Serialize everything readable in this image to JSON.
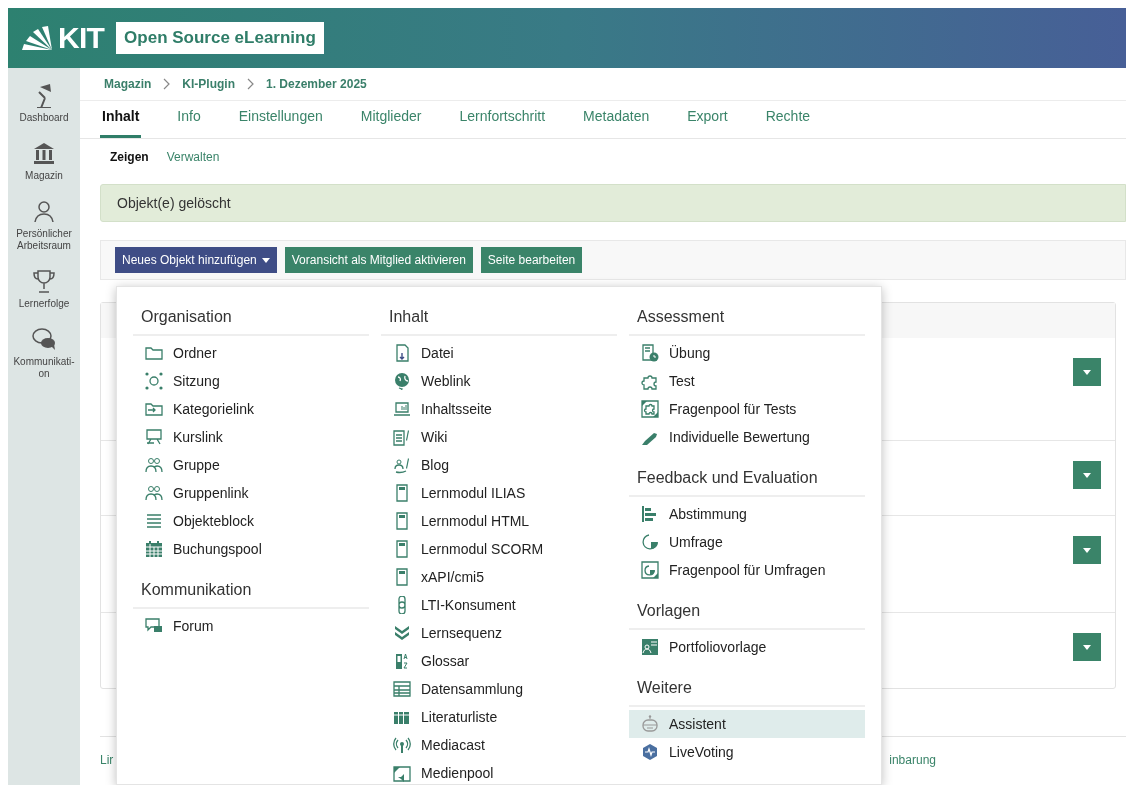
{
  "header": {
    "logo": "KIT",
    "title": "Open Source eLearning"
  },
  "sidebar": {
    "items": [
      {
        "label": "Dashboard"
      },
      {
        "label": "Magazin"
      },
      {
        "label": "Persönlicher\nArbeitsraum"
      },
      {
        "label": "Lernerfolge"
      },
      {
        "label": "Kommunikati-\non"
      }
    ]
  },
  "breadcrumb": [
    "Magazin",
    "KI-Plugin",
    "1. Dezember 2025"
  ],
  "tabs": [
    {
      "label": "Inhalt",
      "selected": true
    },
    {
      "label": "Info",
      "selected": false
    },
    {
      "label": "Einstellungen",
      "selected": false
    },
    {
      "label": "Mitglieder",
      "selected": false
    },
    {
      "label": "Lernfortschritt",
      "selected": false
    },
    {
      "label": "Metadaten",
      "selected": false
    },
    {
      "label": "Export",
      "selected": false
    },
    {
      "label": "Rechte",
      "selected": false
    }
  ],
  "subtabs": [
    {
      "label": "Zeigen",
      "selected": true
    },
    {
      "label": "Verwalten",
      "selected": false
    }
  ],
  "alert": "Objekt(e) gelöscht",
  "toolbar": [
    {
      "label": "Neues Objekt hinzufügen",
      "kind": "dropdown"
    },
    {
      "label": "Voransicht als Mitglied aktivieren",
      "kind": "primary"
    },
    {
      "label": "Seite bearbeiten",
      "kind": "primary"
    }
  ],
  "list_rows": [
    {
      "actions": true
    },
    {
      "actions": true
    },
    {
      "actions": true
    },
    {
      "actions": true
    }
  ],
  "footer_links": [
    "Lir",
    "inbarung"
  ],
  "add_menu": {
    "columns": [
      {
        "sections": [
          {
            "title": "Organisation",
            "items": [
              {
                "label": "Ordner",
                "selected": false
              },
              {
                "label": "Sitzung",
                "selected": false
              },
              {
                "label": "Kategorielink",
                "selected": false
              },
              {
                "label": "Kurslink",
                "selected": false
              },
              {
                "label": "Gruppe",
                "selected": false
              },
              {
                "label": "Gruppenlink",
                "selected": false
              },
              {
                "label": "Objekteblock",
                "selected": false
              },
              {
                "label": "Buchungspool",
                "selected": false
              }
            ]
          },
          {
            "title": "Kommunikation",
            "items": [
              {
                "label": "Forum",
                "selected": false
              }
            ]
          }
        ]
      },
      {
        "sections": [
          {
            "title": "Inhalt",
            "items": [
              {
                "label": "Datei",
                "selected": false
              },
              {
                "label": "Weblink",
                "selected": false
              },
              {
                "label": "Inhaltsseite",
                "selected": false
              },
              {
                "label": "Wiki",
                "selected": false
              },
              {
                "label": "Blog",
                "selected": false
              },
              {
                "label": "Lernmodul ILIAS",
                "selected": false
              },
              {
                "label": "Lernmodul HTML",
                "selected": false
              },
              {
                "label": "Lernmodul SCORM",
                "selected": false
              },
              {
                "label": "xAPI/cmi5",
                "selected": false
              },
              {
                "label": "LTI-Konsument",
                "selected": false
              },
              {
                "label": "Lernsequenz",
                "selected": false
              },
              {
                "label": "Glossar",
                "selected": false
              },
              {
                "label": "Datensammlung",
                "selected": false
              },
              {
                "label": "Literaturliste",
                "selected": false
              },
              {
                "label": "Mediacast",
                "selected": false
              },
              {
                "label": "Medienpool",
                "selected": false
              }
            ]
          }
        ]
      },
      {
        "sections": [
          {
            "title": "Assessment",
            "items": [
              {
                "label": "Übung",
                "selected": false
              },
              {
                "label": "Test",
                "selected": false
              },
              {
                "label": "Fragenpool für Tests",
                "selected": false
              },
              {
                "label": "Individuelle Bewertung",
                "selected": false
              }
            ]
          },
          {
            "title": "Feedback und Evaluation",
            "items": [
              {
                "label": "Abstimmung",
                "selected": false
              },
              {
                "label": "Umfrage",
                "selected": false
              },
              {
                "label": "Fragenpool für Umfragen",
                "selected": false
              }
            ]
          },
          {
            "title": "Vorlagen",
            "items": [
              {
                "label": "Portfoliovorlage",
                "selected": false
              }
            ]
          },
          {
            "title": "Weitere",
            "items": [
              {
                "label": "Assistent",
                "selected": true
              },
              {
                "label": "LiveVoting",
                "selected": false
              }
            ]
          }
        ]
      }
    ]
  }
}
